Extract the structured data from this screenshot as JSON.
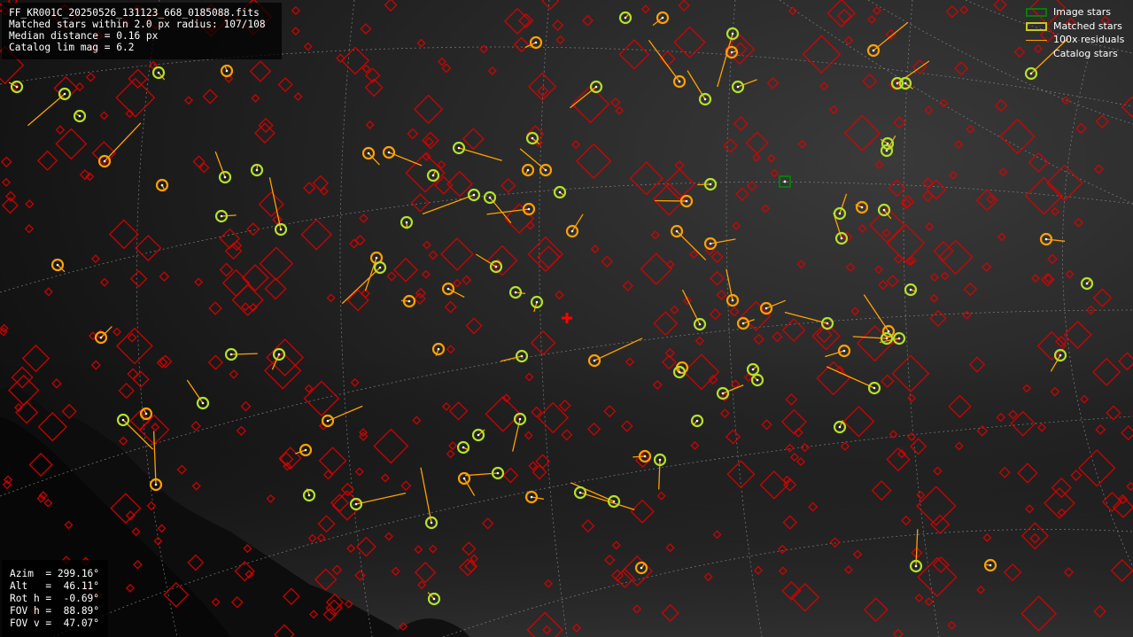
{
  "info": {
    "filename": "FF_KR001C_20250526_131123_668_0185088.fits",
    "matched_line": "Matched stars within 2.0 px radius: 107/108",
    "median_line": "Median distance = 0.16 px",
    "limmag_line": "Catalog lim mag = 6.2"
  },
  "legend": {
    "image_stars": "Image stars",
    "matched_stars": "Matched stars",
    "residuals": "100x residuals",
    "catalog_stars": "Catalog stars"
  },
  "pointing": {
    "azim": "Azim  = 299.16°",
    "alt": "Alt   =  46.11°",
    "rot": "Rot h =  -0.69°",
    "fov_h": "FOV h =  88.89°",
    "fov_v": "FOV v =  47.07°"
  },
  "colors": {
    "image_star": "#0a7a0a",
    "matched_star": "#c8c81e",
    "residual": "#ffa000",
    "catalog_star": "#dd0000",
    "grid": "#8a8a8a",
    "centre_cross": "#ff0000"
  },
  "icons": {
    "centre_marker": "red-cross-icon",
    "image_star_marker": "green-square-icon"
  }
}
